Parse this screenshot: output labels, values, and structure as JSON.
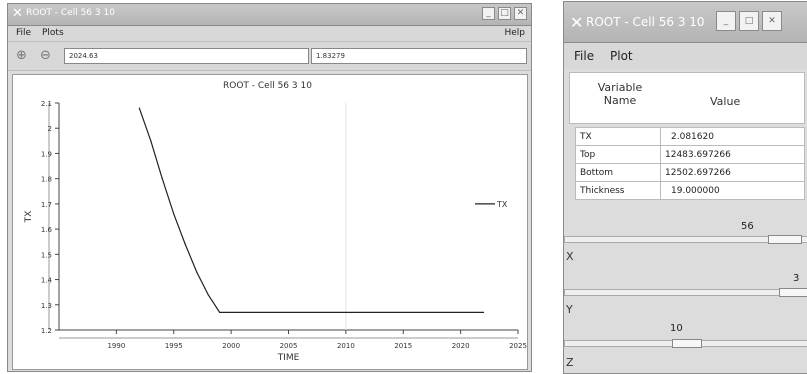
{
  "left_window": {
    "title": "ROOT - Cell 56 3 10",
    "menu": {
      "file": "File",
      "plots": "Plots",
      "help": "Help"
    },
    "toolbar": {
      "zoom_in_icon": "zoom-in-icon",
      "zoom_out_icon": "zoom-out-icon",
      "x_readout": "2024.63",
      "y_readout": "1.83279"
    },
    "plot_title": "ROOT - Cell 56 3 10",
    "legend_label": "TX"
  },
  "right_window": {
    "title": "ROOT - Cell 56 3 10",
    "menu": {
      "file": "File",
      "plot": "Plot"
    },
    "table": {
      "header_variable": "Variable\nName",
      "header_value": "Value",
      "rows": [
        {
          "name": "TX",
          "value": "2.081620"
        },
        {
          "name": "Top",
          "value": "12483.697266"
        },
        {
          "name": "Bottom",
          "value": "12502.697266"
        },
        {
          "name": "Thickness",
          "value": "19.000000"
        }
      ]
    },
    "sliders": {
      "x": {
        "label": "X",
        "value": "56",
        "position": 0.9
      },
      "y": {
        "label": "Y",
        "value": "3",
        "position": 1.0
      },
      "z": {
        "label": "Z",
        "value": "10",
        "position": 0.5
      }
    }
  },
  "chart_data": {
    "type": "line",
    "title": "ROOT - Cell 56 3 10",
    "xlabel": "TIME",
    "ylabel": "TX",
    "xlim": [
      1985,
      2025
    ],
    "ylim": [
      1.2,
      2.1
    ],
    "xticks": [
      "1990",
      "1995",
      "2000",
      "2005",
      "2010",
      "2015",
      "2020",
      "2025"
    ],
    "yticks": [
      "1.2",
      "1.3",
      "1.4",
      "1.5",
      "1.6",
      "1.7",
      "1.8",
      "1.9",
      "2",
      "2.1"
    ],
    "legend": "right",
    "series": [
      {
        "name": "TX",
        "x": [
          1992,
          1993,
          1994,
          1995,
          1996,
          1997,
          1998,
          1999,
          2022
        ],
        "y": [
          2.08,
          1.95,
          1.8,
          1.66,
          1.54,
          1.43,
          1.34,
          1.27,
          1.27
        ]
      }
    ]
  }
}
